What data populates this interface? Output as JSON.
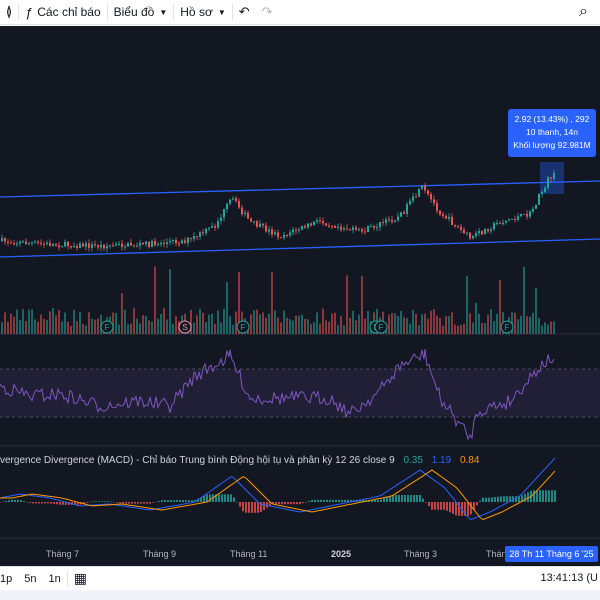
{
  "toolbar": {
    "items": [
      {
        "icon": "≬",
        "label": ""
      },
      {
        "icon": "ƒ",
        "label": "Các chỉ báo"
      },
      {
        "icon": "",
        "label": "Biểu đồ"
      },
      {
        "icon": "",
        "label": "Hồ sơ"
      }
    ],
    "undo_icon": "↶",
    "redo_icon": "↷",
    "search_icon": "⌕"
  },
  "chart": {
    "background": "#131722",
    "channel_color": "#2962ff",
    "up_color": "#26a69a",
    "down_color": "#ef5350",
    "rsi_color": "#7e57c2",
    "tooltip": {
      "line1": "2.92 (13.43%) , 292",
      "line2": "10 thanh, 14n",
      "line3": "Khối lượng 92.981M"
    },
    "events": [
      {
        "letter": "F",
        "color": "#26a69a"
      },
      {
        "letter": "S",
        "color": "#f48fb1"
      },
      {
        "letter": "F",
        "color": "#26a69a"
      },
      {
        "letter": "F",
        "color": "#26a69a"
      },
      {
        "letter": "F",
        "color": "#26a69a"
      },
      {
        "letter": "F",
        "color": "#26a69a"
      }
    ],
    "macd": {
      "title": "vergence Divergence (MACD) - Chỉ báo Trung bình Động hội tụ và phân kỳ 12 26 close 9",
      "histogram": "0.35",
      "macd": "1.19",
      "signal": "0.84"
    },
    "time_axis": [
      "Tháng 7",
      "Tháng 9",
      "Tháng 11",
      "2025",
      "Tháng 3",
      "Thán"
    ],
    "crosshair_label": "28 Th 11 Tháng 6 '25"
  },
  "bottombar": {
    "ranges": [
      "1p",
      "5n",
      "1n"
    ],
    "calendar_icon": "▦",
    "clock": "13:41:13 (U"
  }
}
